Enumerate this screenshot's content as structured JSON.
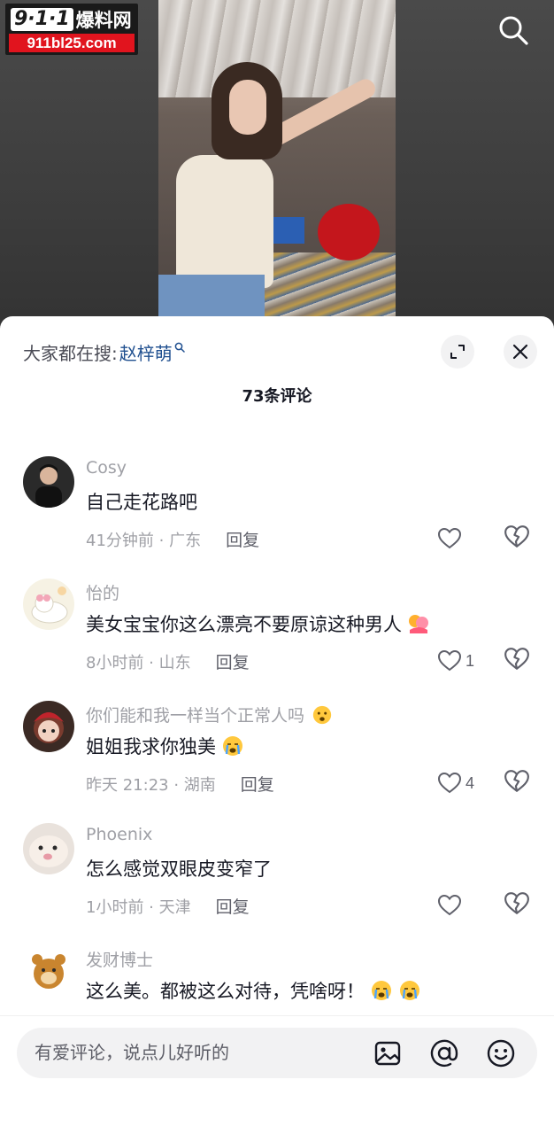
{
  "video": {
    "watermark": {
      "badge": "9·1·1",
      "cn": "爆料网",
      "url": "911bl25.com"
    },
    "search_icon": "search-icon"
  },
  "sheet": {
    "suggest_label": "大家都在搜:",
    "suggest_query": "赵梓萌",
    "comment_count_title": "73条评论"
  },
  "comments": [
    {
      "user": "Cosy",
      "text": "自己走花路吧",
      "meta": "41分钟前 · 广东",
      "reply": "回复",
      "likes": ""
    },
    {
      "user": "怡的",
      "text": "美女宝宝你这么漂亮不要原谅这种男人",
      "emoji": "hug-emoji",
      "meta": "8小时前 · 山东",
      "reply": "回复",
      "likes": "1"
    },
    {
      "user": "你们能和我一样当个正常人吗",
      "user_emoji": "anxious-emoji",
      "text": "姐姐我求你独美",
      "emoji": "crying-emoji",
      "meta": "昨天 21:23 · 湖南",
      "reply": "回复",
      "likes": "4"
    },
    {
      "user": "Phoenix",
      "text": "怎么感觉双眼皮变窄了",
      "meta": "1小时前 · 天津",
      "reply": "回复",
      "likes": ""
    },
    {
      "user": "发财博士",
      "text": "这么美。都被这么对待，凭啥呀！",
      "emoji": "crying-emoji",
      "emoji_count": 2,
      "meta": "",
      "reply": "",
      "likes": ""
    }
  ],
  "input": {
    "placeholder": "有爱评论，说点儿好听的"
  },
  "colors": {
    "accent_link": "#1f4f8f",
    "muted": "#9fa0a6",
    "text": "#161823",
    "watermark_red": "#e1141e"
  }
}
